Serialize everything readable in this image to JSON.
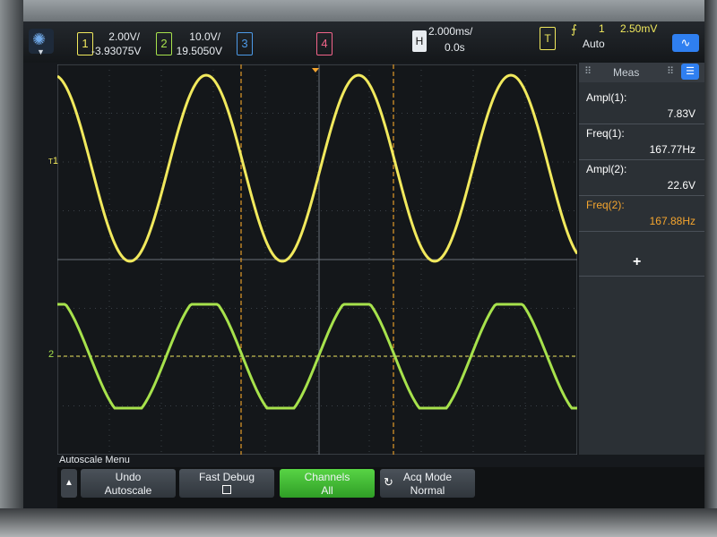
{
  "channels": [
    {
      "num": "1",
      "scale": "2.00V/",
      "offset": "-3.93075V",
      "color": "#f1e95d"
    },
    {
      "num": "2",
      "scale": "10.0V/",
      "offset": "19.5050V",
      "color": "#a7e24c"
    },
    {
      "num": "3",
      "color": "#4d9ae8"
    },
    {
      "num": "4",
      "color": "#f2648a"
    }
  ],
  "timebase": {
    "label": "H",
    "scale": "2.000ms/",
    "delay": "0.0s"
  },
  "trigger": {
    "label": "T",
    "source": "1",
    "level": "2.50mV",
    "mode": "Auto"
  },
  "markers": {
    "ch1": "1",
    "ch2": "2",
    "trig": "T"
  },
  "measurements": {
    "title": "Meas",
    "items": [
      {
        "label": "Ampl(1):",
        "value": "7.83V"
      },
      {
        "label": "Freq(1):",
        "value": "167.77Hz"
      },
      {
        "label": "Ampl(2):",
        "value": "22.6V"
      },
      {
        "label": "Freq(2):",
        "value": "167.88Hz"
      }
    ],
    "add_symbol": "+"
  },
  "menu": {
    "title": "Autoscale Menu",
    "softkeys": [
      {
        "line1": "Undo",
        "line2": "Autoscale"
      },
      {
        "line1": "Fast Debug",
        "line2": ""
      },
      {
        "line1": "Channels",
        "line2": "All"
      },
      {
        "line1": "Acq Mode",
        "line2": "Normal"
      }
    ]
  },
  "colors": {
    "ch1": "#f1e95d",
    "ch2": "#a7e24c",
    "cursor": "#f5a52e",
    "accent": "#2f7ff0"
  },
  "icons": [
    "agilent-logo-icon",
    "trigger-edge-icon",
    "waveform-icon",
    "meas-menu-icon",
    "up-arrow-icon",
    "acq-mode-icon"
  ]
}
